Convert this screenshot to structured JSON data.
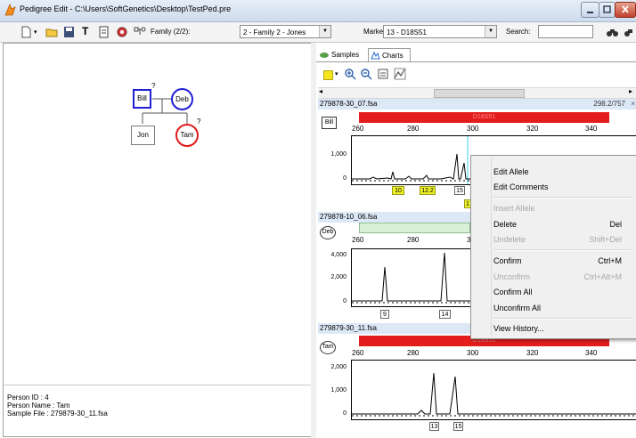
{
  "window": {
    "title": "Pedigree Edit - C:\\Users\\SoftGenetics\\Desktop\\TestPed.pre",
    "buttons": [
      "minimize-icon",
      "maximize-icon",
      "close-icon"
    ]
  },
  "toolbar": {
    "icons": [
      "new-icon",
      "dropdown-arrow-icon",
      "open-folder-icon",
      "save-icon",
      "text-icon",
      "properties-icon",
      "settings-icon",
      "pedigree-icon"
    ],
    "family_label": "Family (2/2):",
    "family_value": "2 - Family 2 - Jones",
    "marker_label": "Marker:",
    "marker_value": "13 - D18S51",
    "search_label": "Search:",
    "search_value": "",
    "search_icons": [
      "binoculars-icon",
      "find-next-icon"
    ]
  },
  "pedigree": {
    "nodes": [
      {
        "label": "Bill",
        "shape": "square",
        "color": "#1f1fd6",
        "mark": "?"
      },
      {
        "label": "Deb",
        "shape": "circle",
        "color": "#1f1fd6",
        "mark": ""
      },
      {
        "label": "Jon",
        "shape": "square",
        "color": "#7a7a7a",
        "mark": ""
      },
      {
        "label": "Tam",
        "shape": "circle",
        "color": "#e01b1b",
        "mark": "?"
      }
    ]
  },
  "info": {
    "person_id": "Person ID   : 4",
    "person_name": "Person Name : Tam",
    "sample_file": "Sample File : 279879-30_11.fsa"
  },
  "right": {
    "tabs": [
      {
        "label": "Samples",
        "icon": "samples-icon"
      },
      {
        "label": "Charts",
        "icon": "charts-icon"
      }
    ],
    "chart_tool_icons": [
      "color-icon",
      "dropdown-arrow-icon",
      "zoom-in-icon",
      "zoom-out-icon",
      "export-icon",
      "chart-settings-icon"
    ]
  },
  "samples": [
    {
      "file": "279878-30_07.fsa",
      "range": "298.2/757",
      "individual": "Bill",
      "marker_name": "D18S51",
      "marker_color": "red",
      "x_ticks": [
        "260",
        "280",
        "300",
        "320",
        "340"
      ],
      "y_ticks": [
        "1,000",
        "0"
      ],
      "alleles": [
        {
          "label": "10",
          "style": "yellow"
        },
        {
          "label": "12.2",
          "style": "yellow"
        },
        {
          "label": "15",
          "style": "white"
        },
        {
          "label": "1",
          "style": "yellow"
        }
      ]
    },
    {
      "file": "279878-10_06.fsa",
      "individual": "Deb",
      "marker_color": "green",
      "x_ticks": [
        "260",
        "280",
        "300"
      ],
      "y_ticks": [
        "4,000",
        "2,000",
        "0"
      ],
      "alleles": [
        {
          "label": "9",
          "style": "white"
        },
        {
          "label": "14",
          "style": "white"
        }
      ]
    },
    {
      "file": "279879-30_11.fsa",
      "individual": "Tam",
      "marker_name": "D18S51",
      "marker_color": "red",
      "x_ticks": [
        "260",
        "280",
        "300",
        "320",
        "340"
      ],
      "y_ticks": [
        "2,000",
        "1,000",
        "0"
      ],
      "alleles": [
        {
          "label": "13",
          "style": "white"
        },
        {
          "label": "15",
          "style": "white"
        }
      ]
    }
  ],
  "context_menu": {
    "items": [
      {
        "label": "Edit Allele",
        "shortcut": "",
        "disabled": false
      },
      {
        "label": "Edit Comments",
        "shortcut": "",
        "disabled": false
      },
      {
        "label": "Insert Allele",
        "shortcut": "",
        "disabled": true
      },
      {
        "label": "Delete",
        "shortcut": "Del",
        "disabled": false
      },
      {
        "label": "Undelete",
        "shortcut": "Shift+Del",
        "disabled": true
      },
      {
        "label": "Confirm",
        "shortcut": "Ctrl+M",
        "disabled": false
      },
      {
        "label": "Unconfirm",
        "shortcut": "Ctrl+Alt+M",
        "disabled": true
      },
      {
        "label": "Confirm All",
        "shortcut": "",
        "disabled": false
      },
      {
        "label": "Unconfirm All",
        "shortcut": "",
        "disabled": false
      },
      {
        "label": "View History...",
        "shortcut": "",
        "disabled": false
      }
    ]
  },
  "colors": {
    "marker_red": "#e31c1c",
    "marker_green": "#d8efd8",
    "allele_yellow": "#eef22a",
    "header_blue": "#dce8f6"
  }
}
